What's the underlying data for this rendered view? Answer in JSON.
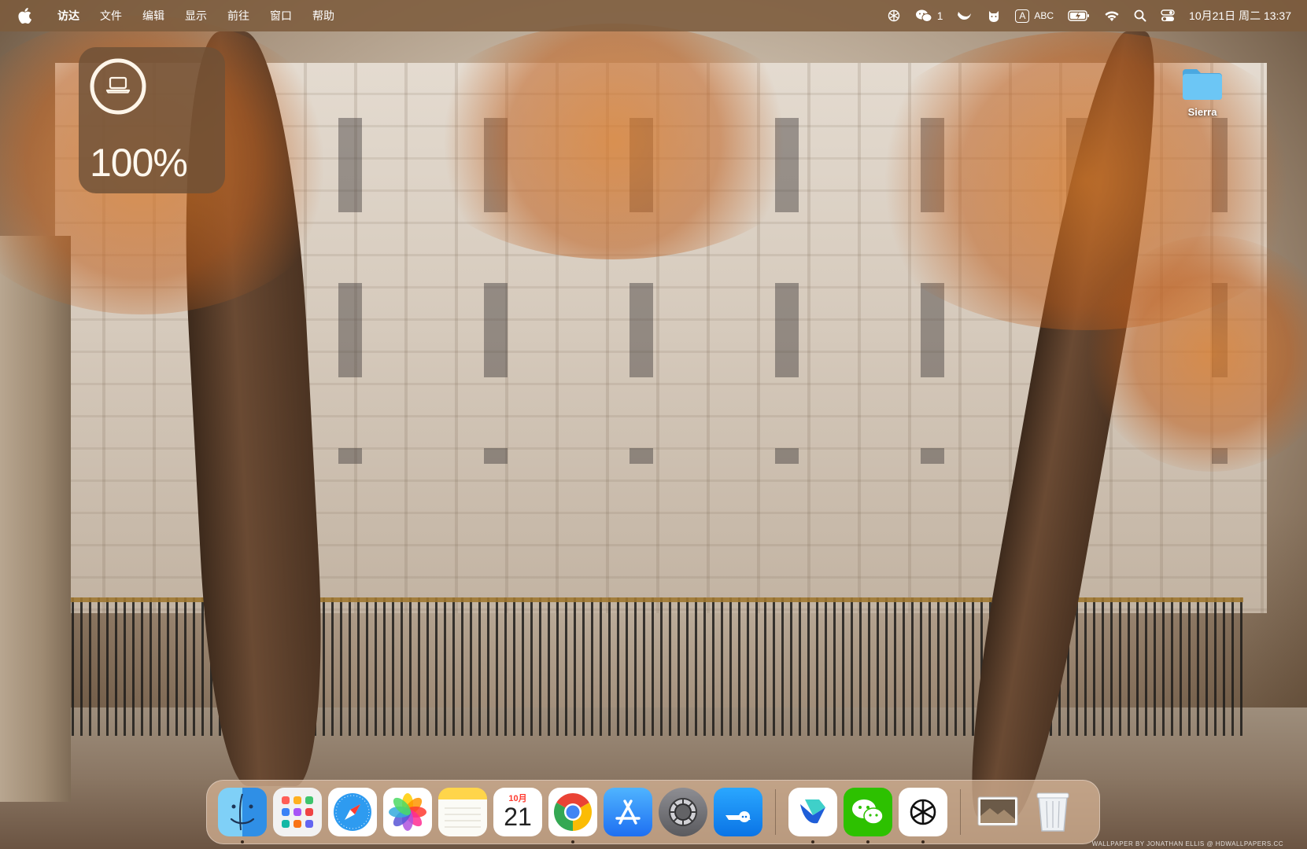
{
  "menubar": {
    "app_name": "访达",
    "menus": [
      "文件",
      "编辑",
      "显示",
      "前往",
      "窗口",
      "帮助"
    ],
    "status": {
      "wechat_count": "1",
      "input_indicator": "A",
      "input_method": "ABC",
      "datetime": "10月21日 周二 13:37"
    },
    "icons": [
      "apple-icon",
      "chatgpt-icon",
      "wechat-icon",
      "bird-icon",
      "cat-icon",
      "input-source-icon",
      "battery-charging-icon",
      "wifi-icon",
      "search-icon",
      "control-center-icon"
    ]
  },
  "battery_widget": {
    "device_icon": "laptop-icon",
    "percent_text": "100%",
    "level": 1.0
  },
  "desktop": {
    "folder_label": "Sierra",
    "wallpaper_credit": "WALLPAPER BY JONATHAN ELLIS @ HDWALLPAPERS.CC"
  },
  "dock": {
    "apps": [
      {
        "name": "Finder",
        "icon": "finder-icon",
        "running": true
      },
      {
        "name": "Launchpad",
        "icon": "launchpad-icon",
        "running": false
      },
      {
        "name": "Safari",
        "icon": "safari-icon",
        "running": false
      },
      {
        "name": "Photos",
        "icon": "photos-icon",
        "running": false
      },
      {
        "name": "Notes",
        "icon": "notes-icon",
        "running": false
      },
      {
        "name": "Calendar",
        "icon": "calendar-icon",
        "running": false,
        "month": "10月",
        "day": "21"
      },
      {
        "name": "Chrome",
        "icon": "chrome-icon",
        "running": true
      },
      {
        "name": "App Store",
        "icon": "app-store-icon",
        "running": false
      },
      {
        "name": "System Settings",
        "icon": "system-settings-icon",
        "running": false
      },
      {
        "name": "Messages Blue",
        "icon": "blue-chat-icon",
        "running": false
      },
      {
        "name": "Lark",
        "icon": "lark-icon",
        "running": true
      },
      {
        "name": "WeChat",
        "icon": "wechat-app-icon",
        "running": true
      },
      {
        "name": "ChatGPT",
        "icon": "chatgpt-app-icon",
        "running": true
      },
      {
        "name": "Downloads Stack",
        "icon": "stack-icon",
        "running": false
      },
      {
        "name": "Trash",
        "icon": "trash-icon",
        "running": false
      }
    ]
  },
  "colors": {
    "menubar_bg": "#7d5c3e",
    "widget_bg": "#6e5037",
    "dock_bg": "#d7b496",
    "folder_blue": "#5ac8fa"
  }
}
